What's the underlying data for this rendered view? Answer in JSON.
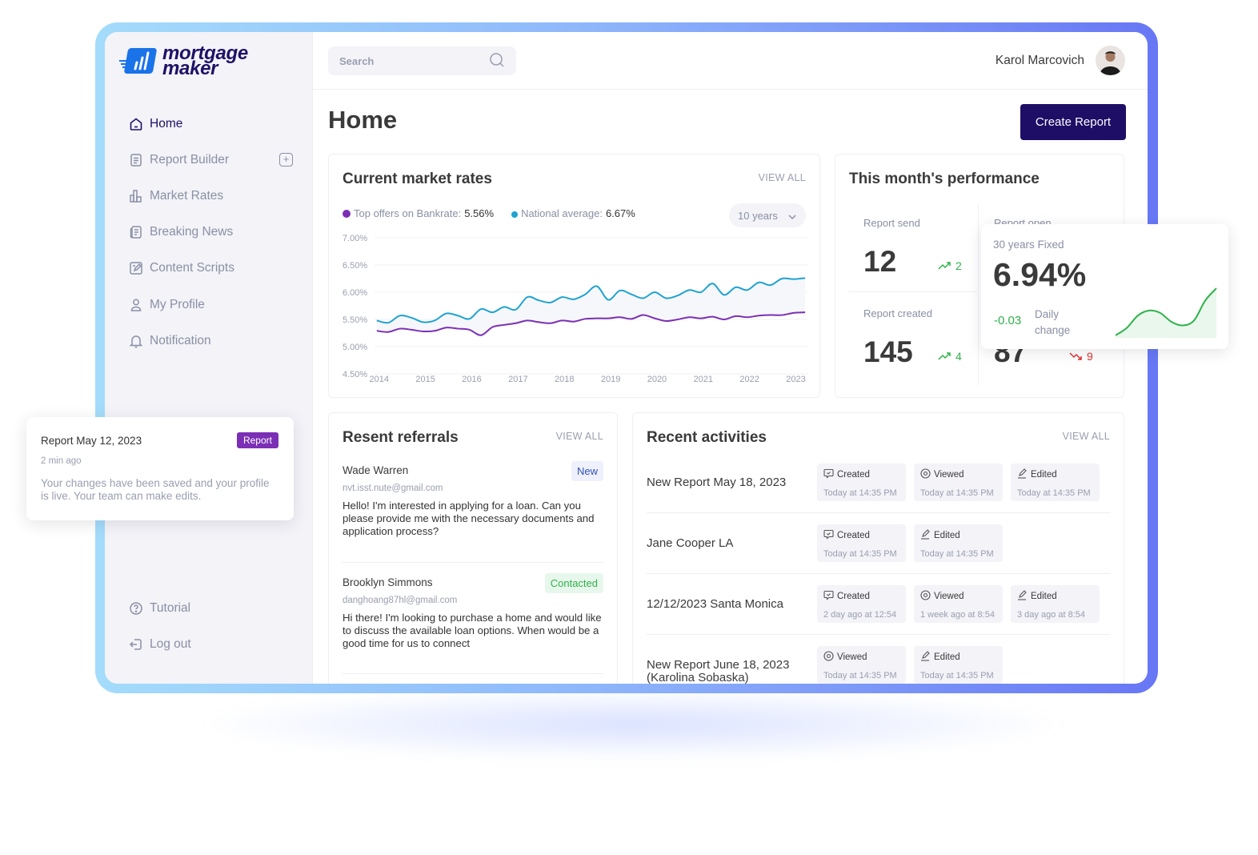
{
  "brand": {
    "line1": "mortgage",
    "line2": "maker",
    "color": "#1e1166",
    "mark_color": "#1a73e8"
  },
  "sidebar": {
    "items": [
      {
        "label": "Home",
        "icon": "home-icon",
        "active": true
      },
      {
        "label": "Report Builder",
        "icon": "document-icon",
        "has_add": true
      },
      {
        "label": "Market Rates",
        "icon": "bar-chart-icon"
      },
      {
        "label": "Breaking News",
        "icon": "newspaper-icon"
      },
      {
        "label": "Content Scripts",
        "icon": "edit-note-icon"
      },
      {
        "label": "My Profile",
        "icon": "user-icon"
      },
      {
        "label": "Notification",
        "icon": "bell-icon"
      }
    ],
    "bottom": [
      {
        "label": "Tutorial",
        "icon": "help-icon"
      },
      {
        "label": "Log out",
        "icon": "logout-icon"
      }
    ]
  },
  "topbar": {
    "search_placeholder": "Search",
    "user_name": "Karol Marcovich"
  },
  "page": {
    "title": "Home",
    "create_label": "Create Report"
  },
  "market": {
    "title": "Current market rates",
    "view_all": "VIEW ALL",
    "legend": [
      {
        "label": "Top offers on Bankrate:",
        "value": "5.56%",
        "color": "#7b2fb5"
      },
      {
        "label": "National average:",
        "value": "6.67%",
        "color": "#1fa3d1"
      }
    ],
    "range": "10 years"
  },
  "chart_data": {
    "type": "line",
    "title": "Current market rates",
    "xlabel": "",
    "ylabel": "",
    "x": [
      2014,
      2014.25,
      2014.5,
      2014.75,
      2015,
      2015.25,
      2015.5,
      2015.75,
      2016,
      2016.25,
      2016.5,
      2016.75,
      2017,
      2017.25,
      2017.5,
      2017.75,
      2018,
      2018.25,
      2018.5,
      2018.75,
      2019,
      2019.25,
      2019.5,
      2019.75,
      2020,
      2020.25,
      2020.5,
      2020.75,
      2021,
      2021.25,
      2021.5,
      2021.75,
      2022,
      2022.25,
      2022.5,
      2022.75,
      2023,
      2023.25
    ],
    "series": [
      {
        "name": "National average",
        "color": "#1fa3d1",
        "values": [
          5.48,
          5.44,
          5.57,
          5.53,
          5.45,
          5.48,
          5.61,
          5.57,
          5.51,
          5.69,
          5.63,
          5.73,
          5.68,
          5.91,
          5.85,
          5.81,
          5.91,
          5.87,
          5.96,
          6.11,
          5.86,
          6.03,
          5.96,
          5.89,
          6.0,
          5.89,
          5.94,
          6.04,
          6.0,
          6.16,
          5.95,
          6.09,
          6.04,
          6.18,
          6.13,
          6.25,
          6.24,
          6.26
        ]
      },
      {
        "name": "Top offers on Bankrate",
        "color": "#7b2fb5",
        "values": [
          5.29,
          5.27,
          5.33,
          5.31,
          5.28,
          5.29,
          5.35,
          5.33,
          5.31,
          5.21,
          5.36,
          5.4,
          5.43,
          5.48,
          5.45,
          5.43,
          5.48,
          5.46,
          5.51,
          5.52,
          5.52,
          5.54,
          5.51,
          5.58,
          5.52,
          5.47,
          5.5,
          5.54,
          5.52,
          5.55,
          5.5,
          5.56,
          5.54,
          5.57,
          5.58,
          5.58,
          5.62,
          5.63
        ]
      }
    ],
    "yticks": [
      "7.00%",
      "6.50%",
      "6.00%",
      "5.50%",
      "5.00%",
      "4.50%"
    ],
    "xticks": [
      "2014",
      "2015",
      "2016",
      "2017",
      "2018",
      "2019",
      "2020",
      "2021",
      "2022",
      "2023"
    ],
    "ylim": [
      4.5,
      7.0
    ],
    "xlim": [
      2013.95,
      2023.3
    ],
    "grid": true
  },
  "performance": {
    "title": "This month's performance",
    "stats": [
      {
        "label": "Report send",
        "value": "12",
        "delta": "2",
        "trend": "up"
      },
      {
        "label": "Report open",
        "value": "",
        "delta": "",
        "trend": "up"
      },
      {
        "label": "Report created",
        "value": "145",
        "delta": "4",
        "trend": "up"
      },
      {
        "label": "",
        "value": "87",
        "delta": "9",
        "trend": "down"
      }
    ]
  },
  "rate_popup": {
    "label": "30 years Fixed",
    "value": "6.94%",
    "change": "-0.03",
    "change_label_1": "Daily",
    "change_label_2": "change",
    "trend_color": "#2fb14b",
    "spark": [
      0.05,
      0.2,
      0.45,
      0.55,
      0.5,
      0.32,
      0.25,
      0.35,
      0.75,
      1.0
    ]
  },
  "notification": {
    "title": "Report May 12, 2023",
    "badge": "Report",
    "badge_color": "#7b2fb5",
    "time": "2 min ago",
    "message": "Your changes have been saved and your profile is live. Your team can make edits."
  },
  "referrals": {
    "title": "Resent referrals",
    "view_all": "VIEW ALL",
    "items": [
      {
        "name": "Wade Warren",
        "email": "nvt.isst.nute@gmail.com",
        "status": "New",
        "message": "Hello! I'm interested in applying for a loan. Can you please provide me with the necessary documents and application process?"
      },
      {
        "name": "Brooklyn Simmons",
        "email": "danghoang87hl@gmail.com",
        "status": "Contacted",
        "message": "Hi there! I'm looking to purchase a home and would like to discuss the available loan options. When would be a good time for us to connect"
      }
    ]
  },
  "activities": {
    "title": "Recent activities",
    "view_all": "VIEW ALL",
    "rows": [
      {
        "title": "New Report May 18, 2023",
        "events": [
          {
            "type": "Created",
            "icon": "chat-check-icon",
            "time": "Today at 14:35 PM"
          },
          {
            "type": "Viewed",
            "icon": "eye-icon",
            "time": "Today at 14:35 PM"
          },
          {
            "type": "Edited",
            "icon": "pencil-icon",
            "time": "Today at 14:35 PM"
          }
        ]
      },
      {
        "title": "Jane Cooper LA",
        "events": [
          {
            "type": "Created",
            "icon": "chat-check-icon",
            "time": "Today at 14:35 PM"
          },
          {
            "type": "Edited",
            "icon": "pencil-icon",
            "time": "Today at 14:35 PM"
          }
        ]
      },
      {
        "title": "12/12/2023 Santa Monica",
        "events": [
          {
            "type": "Created",
            "icon": "chat-check-icon",
            "time": "2 day ago at 12:54"
          },
          {
            "type": "Viewed",
            "icon": "eye-icon",
            "time": "1 week ago at 8:54"
          },
          {
            "type": "Edited",
            "icon": "pencil-icon",
            "time": "3 day ago at 8:54"
          }
        ]
      },
      {
        "title": "New Report June 18, 2023 (Karolina Sobaska)",
        "events": [
          {
            "type": "Viewed",
            "icon": "eye-icon",
            "time": "Today at 14:35 PM"
          },
          {
            "type": "Edited",
            "icon": "pencil-icon",
            "time": "Today at 14:35 PM"
          }
        ]
      }
    ]
  }
}
